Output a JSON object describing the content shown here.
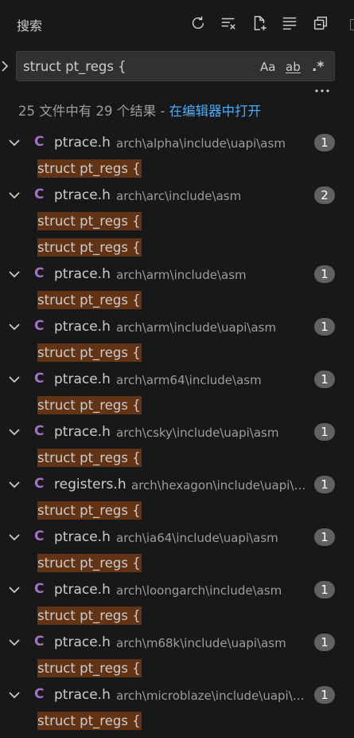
{
  "header": {
    "title": "搜索",
    "icons": [
      "refresh-icon",
      "clear-results-icon",
      "new-search-editor-icon",
      "view-as-tree-icon",
      "collapse-all-icon"
    ]
  },
  "search": {
    "query": "struct pt_regs {",
    "options": {
      "match_case": "Aa",
      "match_word": "ab",
      "regex": ".*"
    }
  },
  "summary": {
    "text": "25 文件中有 29 个结果 - ",
    "link": "在编辑器中打开"
  },
  "colors": {
    "background": "#181818",
    "match_highlight": "#623315",
    "link": "#4daafc",
    "c_file_icon": "#a074c4",
    "badge": "#616161"
  },
  "results": [
    {
      "file": "ptrace.h",
      "path": "arch\\alpha\\include\\uapi\\asm",
      "count": "1",
      "matches": [
        "struct pt_regs {"
      ]
    },
    {
      "file": "ptrace.h",
      "path": "arch\\arc\\include\\asm",
      "count": "2",
      "matches": [
        "struct pt_regs {",
        "struct pt_regs {"
      ]
    },
    {
      "file": "ptrace.h",
      "path": "arch\\arm\\include\\asm",
      "count": "1",
      "matches": [
        "struct pt_regs {"
      ]
    },
    {
      "file": "ptrace.h",
      "path": "arch\\arm\\include\\uapi\\asm",
      "count": "1",
      "matches": [
        "struct pt_regs {"
      ]
    },
    {
      "file": "ptrace.h",
      "path": "arch\\arm64\\include\\asm",
      "count": "1",
      "matches": [
        "struct pt_regs {"
      ]
    },
    {
      "file": "ptrace.h",
      "path": "arch\\csky\\include\\uapi\\asm",
      "count": "1",
      "matches": [
        "struct pt_regs {"
      ]
    },
    {
      "file": "registers.h",
      "path": "arch\\hexagon\\include\\uapi\\asm",
      "count": "1",
      "matches": [
        "struct pt_regs {"
      ]
    },
    {
      "file": "ptrace.h",
      "path": "arch\\ia64\\include\\uapi\\asm",
      "count": "1",
      "matches": [
        "struct pt_regs {"
      ]
    },
    {
      "file": "ptrace.h",
      "path": "arch\\loongarch\\include\\asm",
      "count": "1",
      "matches": [
        "struct pt_regs {"
      ]
    },
    {
      "file": "ptrace.h",
      "path": "arch\\m68k\\include\\uapi\\asm",
      "count": "1",
      "matches": [
        "struct pt_regs {"
      ]
    },
    {
      "file": "ptrace.h",
      "path": "arch\\microblaze\\include\\uapi\\asm",
      "count": "1",
      "matches": [
        "struct pt_regs {"
      ]
    }
  ]
}
